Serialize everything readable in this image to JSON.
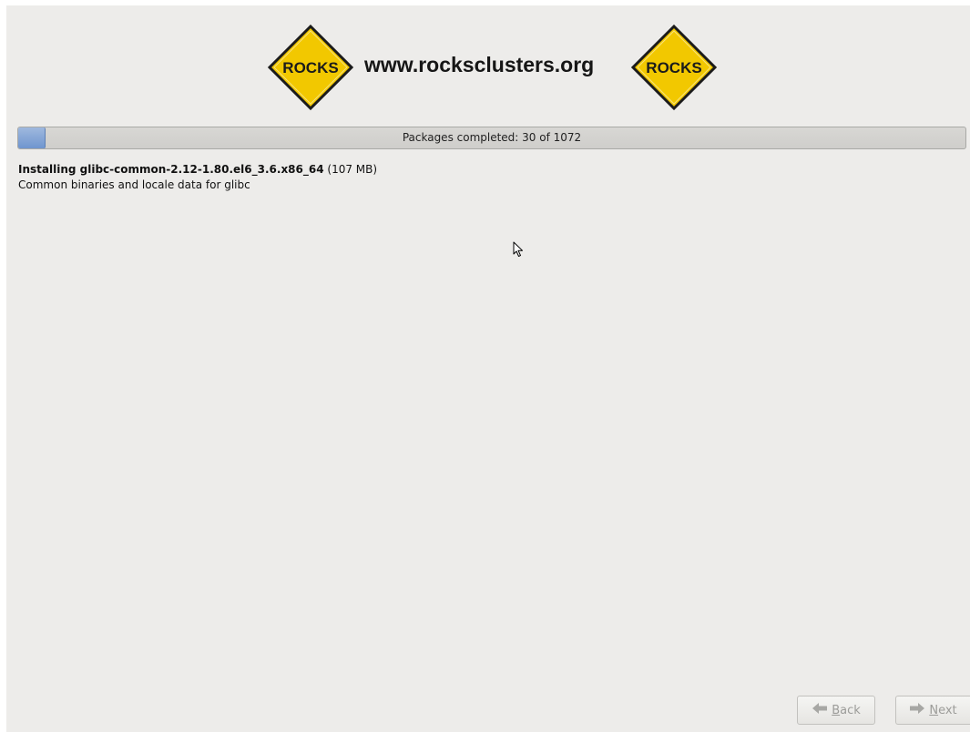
{
  "header": {
    "logo_text": "ROCKS",
    "site_title": "www.rocksclusters.org",
    "brand_color": "#f2c800"
  },
  "progress": {
    "label": "Packages completed: 30 of 1072",
    "completed": 30,
    "total": 1072
  },
  "current_package": {
    "prefix": "Installing ",
    "name": "glibc-common-2.12-1.80.el6_3.6.x86_64",
    "size": " (107 MB)",
    "summary": "Common binaries and locale data for glibc"
  },
  "buttons": {
    "back": {
      "mnemonic": "B",
      "rest": "ack",
      "icon": "arrow-left-icon"
    },
    "next": {
      "mnemonic": "N",
      "rest": "ext",
      "icon": "arrow-right-icon"
    }
  }
}
